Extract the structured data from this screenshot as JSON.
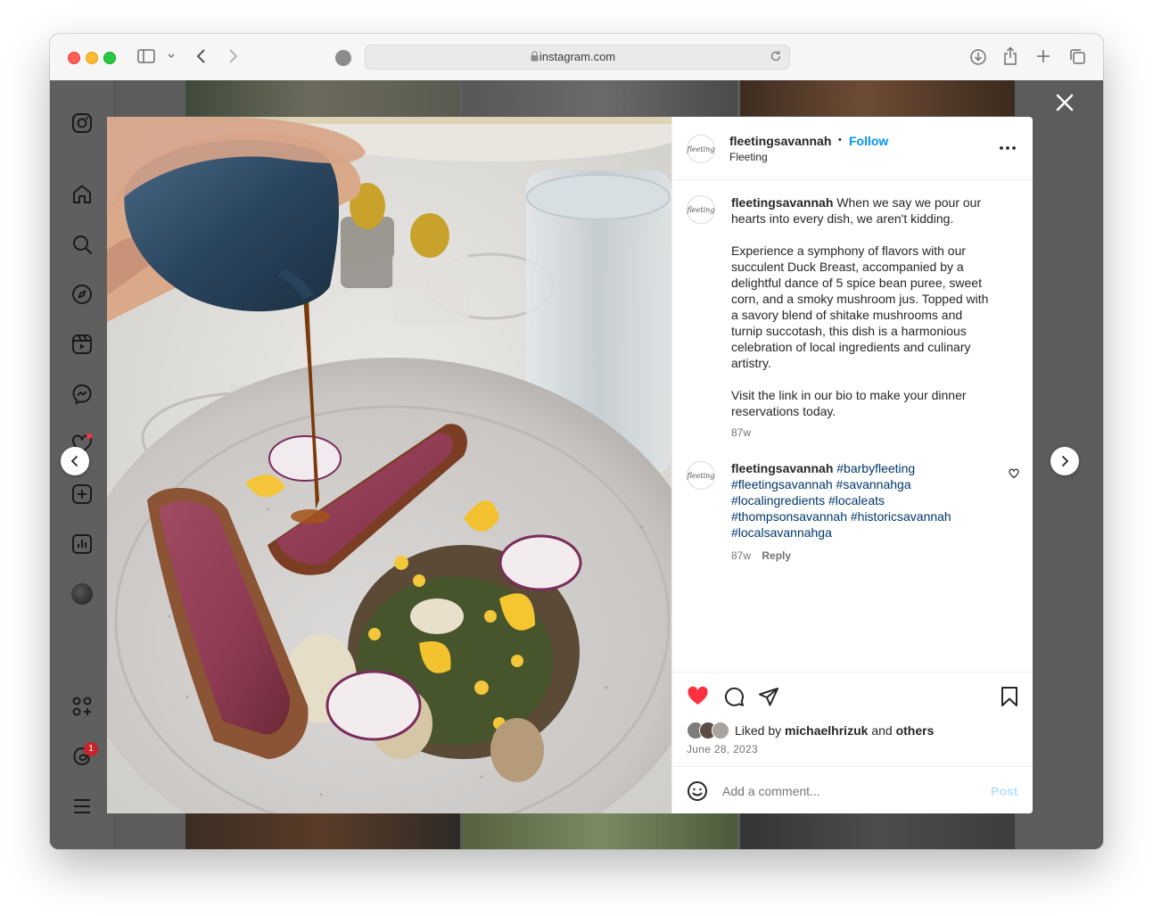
{
  "browser": {
    "url": "instagram.com"
  },
  "post": {
    "username": "fleetingsavannah",
    "follow_label": "Follow",
    "separator": "•",
    "location": "Fleeting",
    "avatar_text": "fleeting",
    "caption": {
      "username": "fleetingsavannah",
      "line1": "When we say we pour our",
      "line2": "hearts into every dish, we aren't kidding.",
      "p2": [
        "Experience a symphony of flavors with our",
        "succulent Duck Breast, accompanied by a",
        "delightful dance of 5 spice bean puree, sweet",
        "corn, and a smoky mushroom jus. Topped with",
        "a savory blend of shitake mushrooms and",
        "turnip succotash, this dish is a harmonious",
        "celebration of local ingredients and culinary",
        "artistry."
      ],
      "p3": [
        "Visit the link in our bio to make your dinner",
        "reservations today."
      ],
      "time": "87w"
    },
    "comment": {
      "username": "fleetingsavannah",
      "tags_line1": "#barbyfleeting",
      "tags_line2": "#fleetingsavannah #savannahga",
      "tags_line3": "#localingredients #localeats",
      "tags_line4": "#thompsonsavannah #historicsavannah",
      "tags_line5": "#localsavannahga",
      "time": "87w",
      "reply_label": "Reply"
    },
    "likes": {
      "prefix": "Liked by",
      "user": "michaelhrizuk",
      "conj": "and",
      "others": "others"
    },
    "date": "June 28, 2023",
    "comment_placeholder": "Add a comment...",
    "post_label": "Post"
  },
  "sidebar": {
    "notification_count": "1"
  },
  "colors": {
    "like_red": "#ff3040",
    "link_blue": "#0095f6",
    "hashtag": "#00376b"
  }
}
